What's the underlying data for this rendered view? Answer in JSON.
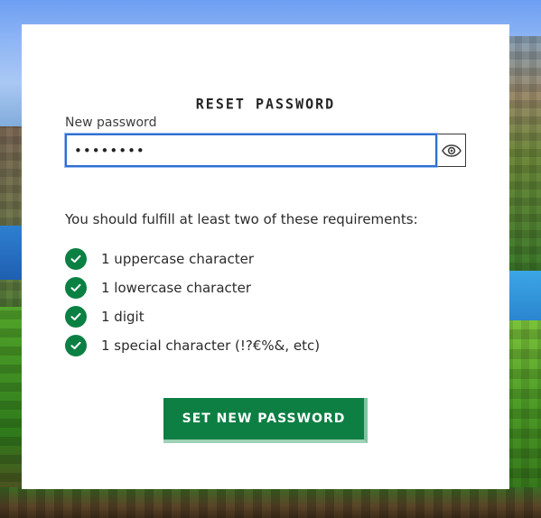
{
  "form": {
    "title": "RESET PASSWORD",
    "password_label": "New password",
    "password_value": "••••••••",
    "requirements_intro": "You should fulfill at least two of these requirements:",
    "requirements": [
      {
        "label": "1 uppercase character",
        "met": true
      },
      {
        "label": "1 lowercase character",
        "met": true
      },
      {
        "label": "1 digit",
        "met": true
      },
      {
        "label": "1 special character (!?€%&, etc)",
        "met": true
      }
    ],
    "submit_label": "SET NEW PASSWORD"
  },
  "icons": {
    "toggle_visibility": "eye-icon",
    "requirement_met": "check-circle-icon"
  },
  "colors": {
    "accent_green": "#0d7f43",
    "focus_blue": "#2e6fd1",
    "card_background": "#ffffff"
  }
}
